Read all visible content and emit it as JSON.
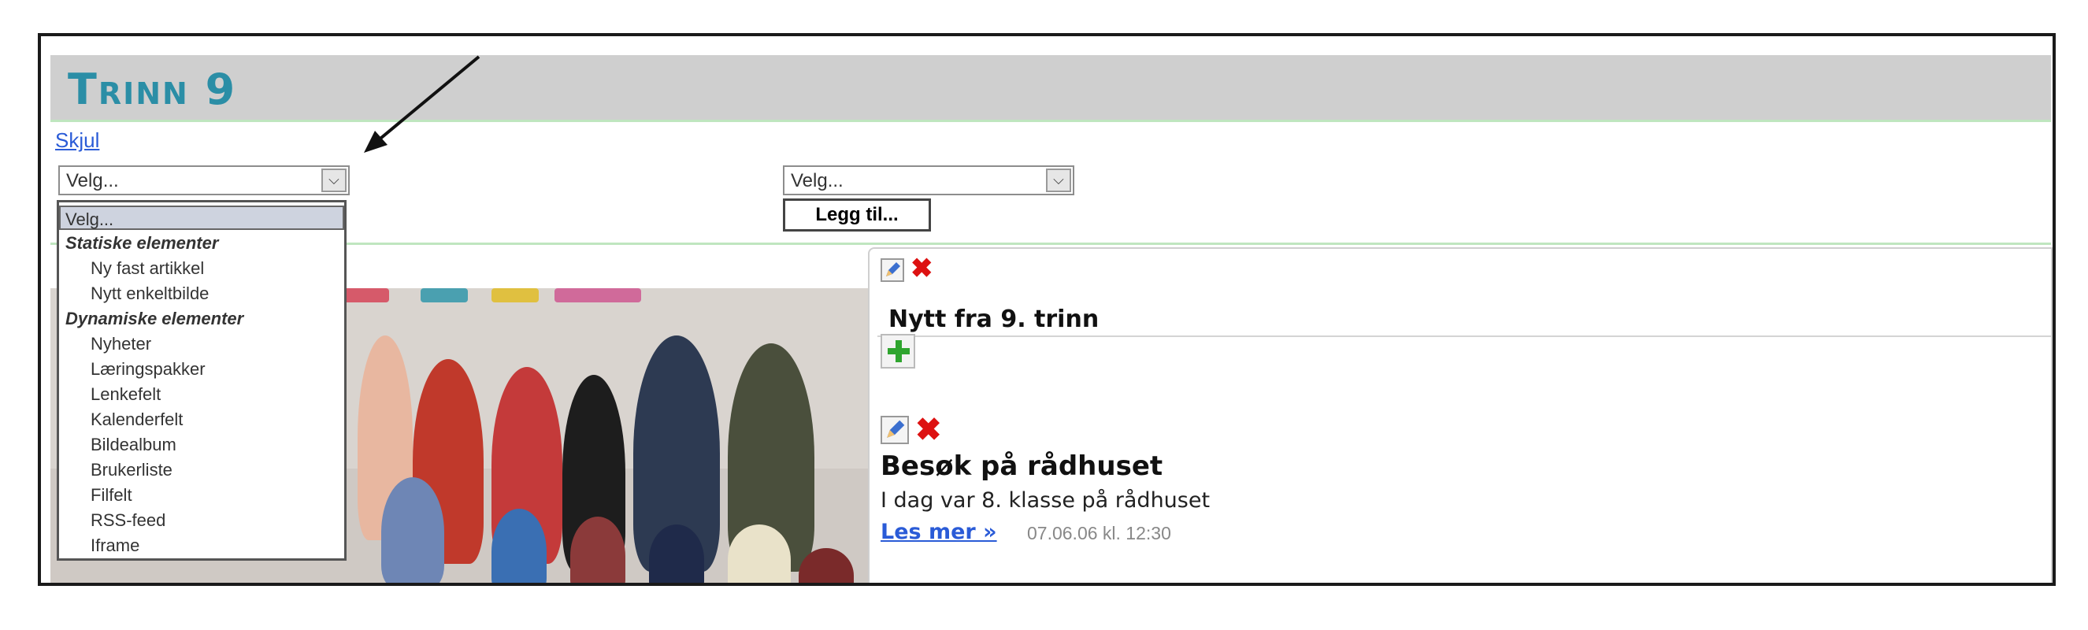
{
  "page": {
    "title": "Trinn 9",
    "hide_link": "Skjul"
  },
  "left_select": {
    "value": "Velg...",
    "options": [
      {
        "label": "Velg...",
        "kind": "selected"
      },
      {
        "label": "Statiske elementer",
        "kind": "group"
      },
      {
        "label": "Ny fast artikkel",
        "kind": "option"
      },
      {
        "label": "Nytt enkeltbilde",
        "kind": "option"
      },
      {
        "label": "Dynamiske elementer",
        "kind": "group"
      },
      {
        "label": "Nyheter",
        "kind": "option"
      },
      {
        "label": "Læringspakker",
        "kind": "option"
      },
      {
        "label": "Lenkefelt",
        "kind": "option"
      },
      {
        "label": "Kalenderfelt",
        "kind": "option"
      },
      {
        "label": "Bildealbum",
        "kind": "option"
      },
      {
        "label": "Brukerliste",
        "kind": "option"
      },
      {
        "label": "Filfelt",
        "kind": "option"
      },
      {
        "label": "RSS-feed",
        "kind": "option"
      },
      {
        "label": "Iframe",
        "kind": "option"
      }
    ]
  },
  "right_select": {
    "value": "Velg...",
    "add_button": "Legg til..."
  },
  "news_section": {
    "title": "Nytt fra 9. trinn",
    "item": {
      "title": "Besøk på rådhuset",
      "text": "I dag var 8. klasse på rådhuset",
      "read_more": "Les mer »",
      "timestamp": "07.06.06 kl. 12:30"
    }
  },
  "colors": {
    "title": "#2b8ea6",
    "header_bg": "#cfcfcf",
    "link": "#2a5bd7",
    "delete": "#dd1111",
    "add": "#2fa52f"
  },
  "icons": [
    "edit-icon",
    "delete-icon",
    "add-icon",
    "dropdown-arrow-icon",
    "annotation-arrow"
  ]
}
